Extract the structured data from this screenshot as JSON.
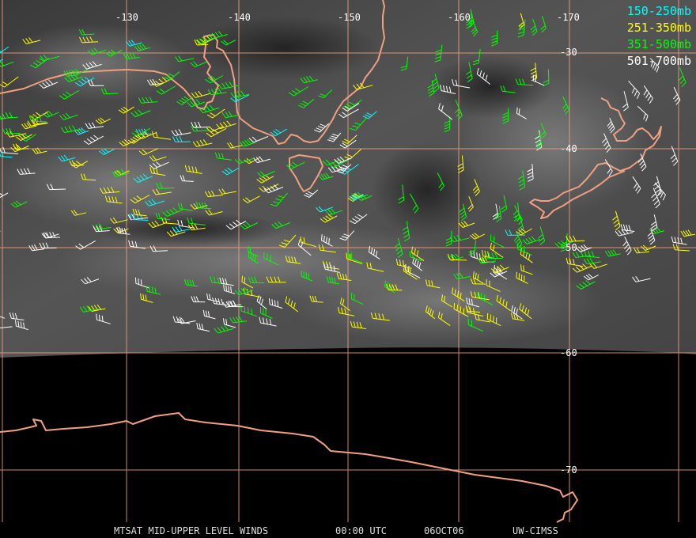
{
  "legend": [
    {
      "label": "150-250mb",
      "color": "#00ffff"
    },
    {
      "label": "251-350mb",
      "color": "#ffff00"
    },
    {
      "label": "351-500mb",
      "color": "#00ff00"
    },
    {
      "label": "501-700mb",
      "color": "#ffffff"
    }
  ],
  "longitude_labels": [
    "-130",
    "-140",
    "-150",
    "-160",
    "-170"
  ],
  "latitude_labels": [
    "-30",
    "-40",
    "-50",
    "-60",
    "-70"
  ],
  "footer": {
    "product": "MTSAT MID-UPPER LEVEL WINDS",
    "time": "00:00 UTC",
    "date": "06OCT06",
    "source": "UW-CIMSS"
  },
  "colors": {
    "grid": "#f0a080",
    "coastline": "#f0a080",
    "background": "#000000"
  }
}
